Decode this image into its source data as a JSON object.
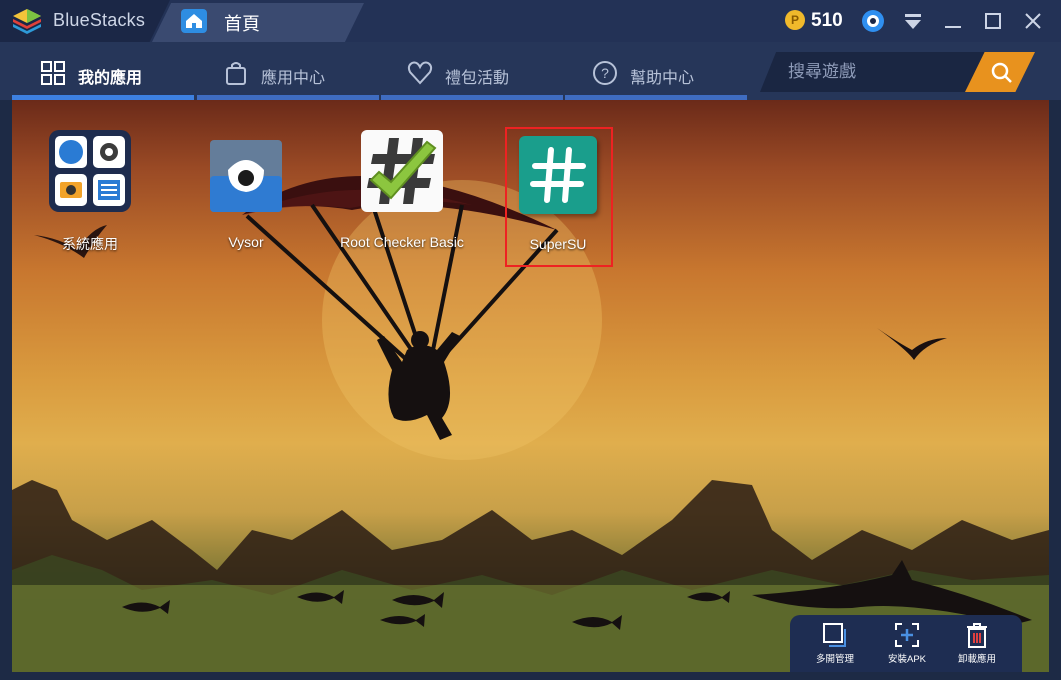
{
  "window": {
    "brand": "BlueStacks",
    "tab": "首頁",
    "coins": "510",
    "coin_symbol": "P",
    "controls": [
      "profile-icon",
      "menu-icon",
      "minimize-icon",
      "maximize-icon",
      "close-icon"
    ]
  },
  "nav": {
    "items": [
      {
        "label": "我的應用",
        "icon": "grid-icon",
        "active": true
      },
      {
        "label": "應用中心",
        "icon": "bag-icon",
        "active": false
      },
      {
        "label": "禮包活動",
        "icon": "heart-icon",
        "active": false
      },
      {
        "label": "幫助中心",
        "icon": "help-icon",
        "active": false
      }
    ],
    "search_placeholder": "搜尋遊戲"
  },
  "apps": [
    {
      "label": "系統應用",
      "icon": "system-apps-icon"
    },
    {
      "label": "Vysor",
      "icon": "vysor-icon"
    },
    {
      "label": "Root Checker Basic",
      "icon": "root-checker-icon"
    },
    {
      "label": "SuperSU",
      "icon": "supersu-icon",
      "highlighted": true
    }
  ],
  "bottom_bar": {
    "buttons": [
      {
        "label": "多開管理",
        "icon": "multi-instance-icon"
      },
      {
        "label": "安裝APK",
        "icon": "install-apk-icon"
      },
      {
        "label": "卸載應用",
        "icon": "uninstall-icon"
      }
    ]
  },
  "colors": {
    "titlebar": "#233256",
    "nav_active_bar": "#3d80e0",
    "search_button": "#e8921e",
    "supersu": "#1a9e8c",
    "highlight_border": "#ee2222"
  }
}
